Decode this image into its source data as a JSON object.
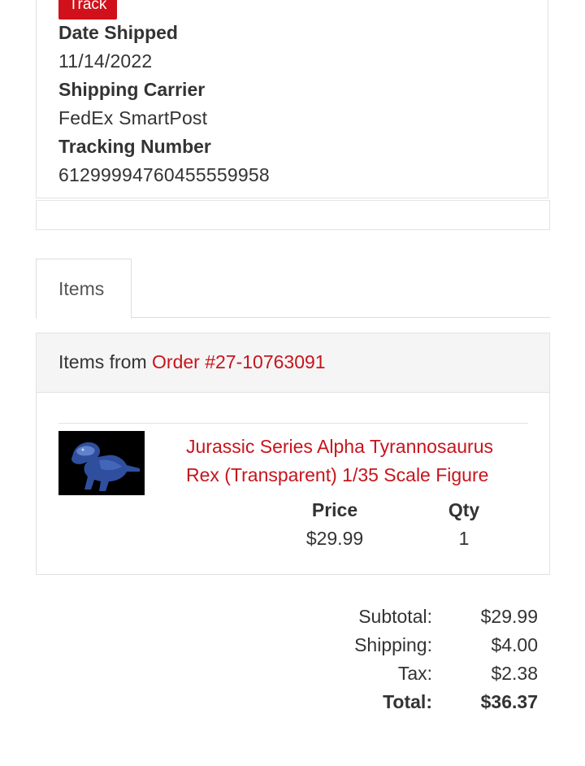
{
  "shipment": {
    "track_label": "Track",
    "date_shipped_label": "Date Shipped",
    "date_shipped_value": "11/14/2022",
    "carrier_label": "Shipping Carrier",
    "carrier_value": "FedEx SmartPost",
    "tracking_label": "Tracking Number",
    "tracking_value": "61299994760455559958"
  },
  "tabs": [
    {
      "label": "Items"
    }
  ],
  "items_panel": {
    "header_prefix": "Items from ",
    "order_link": "Order #27-10763091",
    "items": [
      {
        "title": "Jurassic Series Alpha Tyrannosaurus Rex (Transparent) 1/35 Scale Figure",
        "thumbnail": "t-rex-figure-image",
        "price_label": "Price",
        "price_value": "$29.99",
        "qty_label": "Qty",
        "qty_value": "1"
      }
    ]
  },
  "totals": {
    "subtotal_label": "Subtotal:",
    "subtotal_value": "$29.99",
    "shipping_label": "Shipping:",
    "shipping_value": "$4.00",
    "tax_label": "Tax:",
    "tax_value": "$2.38",
    "total_label": "Total:",
    "total_value": "$36.37"
  },
  "colors": {
    "accent": "#c8141c",
    "track_button": "#d0101a",
    "panel_header_bg": "#f5f5f5"
  }
}
